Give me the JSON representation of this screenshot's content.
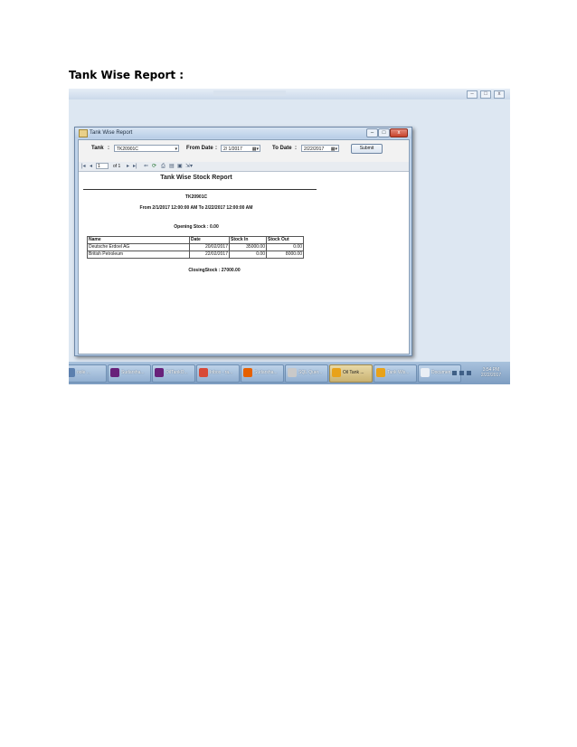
{
  "document": {
    "heading": "Tank Wise Report :"
  },
  "window": {
    "title": "Tank Wise Report",
    "min_glyph": "–",
    "max_glyph": "□",
    "close_glyph": "x"
  },
  "form": {
    "tank_label": "Tank",
    "tank_separator": ":",
    "tank_value": "TK20901C",
    "from_label": "From Date",
    "from_separator": ":",
    "from_value": "2/ 1/2017",
    "to_label": "To Date",
    "to_separator": ":",
    "to_value": "2/22/2017",
    "submit_label": "Submit"
  },
  "viewer": {
    "page_current": "1",
    "page_of": "of 1"
  },
  "report": {
    "title": "Tank Wise Stock Report",
    "tank": "TK20901C",
    "range": "From 2/1/2017 12:00:00 AM To 2/22/2017 12:00:00 AM",
    "opening": "Opening Stock : 0.00",
    "closing": "ClosingStock : 27000.00",
    "columns": [
      "Name",
      "Date",
      "Stock In",
      "Stock Out"
    ],
    "rows": [
      [
        "Deutsche Erdoel AG",
        "20/02/2017",
        "35000.00",
        "0.00"
      ],
      [
        "British Petroleum",
        "22/02/2017",
        "0.00",
        "8000.00"
      ]
    ]
  },
  "taskbar": {
    "items": [
      {
        "label": "oole ...",
        "icon_color": "#5b7fae",
        "icon": "app-icon"
      },
      {
        "label": "Sudarsha...",
        "icon_color": "#68217a",
        "icon": "visual-studio-icon"
      },
      {
        "label": "OilTankO...",
        "icon_color": "#68217a",
        "icon": "visual-studio-icon"
      },
      {
        "label": "Inbox - ra...",
        "icon_color": "#d84a38",
        "icon": "chrome-icon"
      },
      {
        "label": "Sudarsha...",
        "icon_color": "#e66000",
        "icon": "firefox-icon"
      },
      {
        "label": "SQL Quer...",
        "icon_color": "#c9c9c9",
        "icon": "sql-server-icon"
      },
      {
        "label": "Oil Tank ...",
        "icon_color": "#e8a21a",
        "icon": "winform-icon"
      },
      {
        "label": "Tank Wis...",
        "icon_color": "#e8a21a",
        "icon": "winform-icon"
      },
      {
        "label": "Documen...",
        "icon_color": "#e9eef5",
        "icon": "document-icon"
      }
    ],
    "clock_time": "3:54 PM",
    "clock_date": "2/22/2017"
  }
}
